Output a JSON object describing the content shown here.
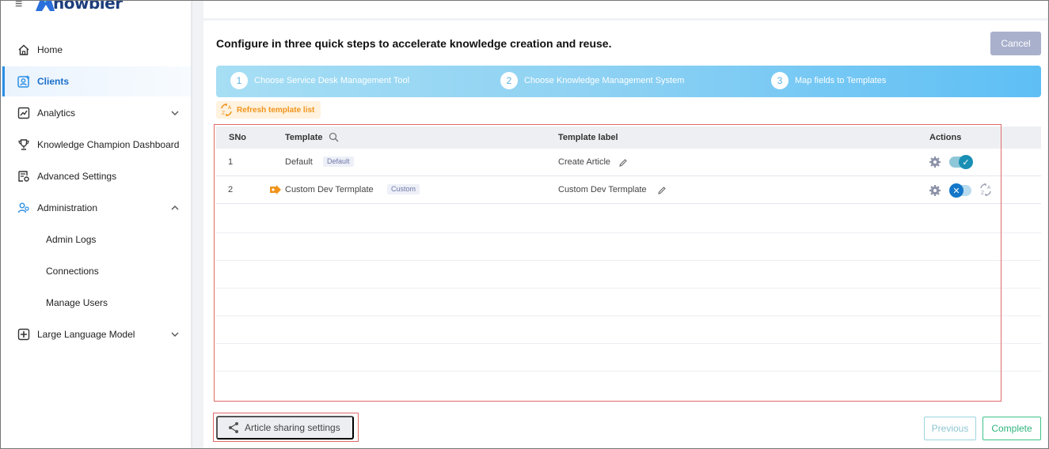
{
  "brand": {
    "name": "nowbler",
    "menu_icon": "hamburger-icon"
  },
  "sidebar": {
    "items": [
      {
        "label": "Home",
        "icon": "home-icon"
      },
      {
        "label": "Clients",
        "icon": "clients-icon",
        "active": true
      },
      {
        "label": "Analytics",
        "icon": "analytics-icon",
        "chevron": "down"
      },
      {
        "label": "Knowledge Champion Dashboard",
        "icon": "trophy-icon"
      },
      {
        "label": "Advanced Settings",
        "icon": "settings-doc-icon"
      },
      {
        "label": "Administration",
        "icon": "admin-users-icon",
        "chevron": "up"
      },
      {
        "label": "Admin Logs",
        "sub": true
      },
      {
        "label": "Connections",
        "sub": true
      },
      {
        "label": "Manage Users",
        "sub": true
      },
      {
        "label": "Large Language Model",
        "icon": "llm-icon",
        "chevron": "down"
      }
    ]
  },
  "main": {
    "heading": "Configure in three quick steps to accelerate knowledge creation and reuse.",
    "cancel_label": "Cancel",
    "steps": [
      {
        "num": "1",
        "label": "Choose Service Desk Management Tool"
      },
      {
        "num": "2",
        "label": "Choose Knowledge Management System"
      },
      {
        "num": "3",
        "label": "Map fields to Templates"
      }
    ],
    "refresh_label": "Refresh template list",
    "table": {
      "headers": {
        "sno": "SNo",
        "template": "Template",
        "label": "Template label",
        "actions": "Actions"
      },
      "rows": [
        {
          "sno": "1",
          "template": "Default",
          "tag": "Default",
          "label": "Create Article",
          "enabled": true
        },
        {
          "sno": "2",
          "template": "Custom Dev Termplate",
          "tag": "Custom",
          "label": "Custom Dev Termplate",
          "enabled": false
        }
      ]
    },
    "share_label": "Article sharing settings",
    "previous_label": "Previous",
    "complete_label": "Complete"
  },
  "colors": {
    "accent": "#2b8fe3",
    "stepper": "#5ebff5",
    "warning": "#f0941c",
    "success": "#2fb47d",
    "highlight": "#e06a6a"
  }
}
